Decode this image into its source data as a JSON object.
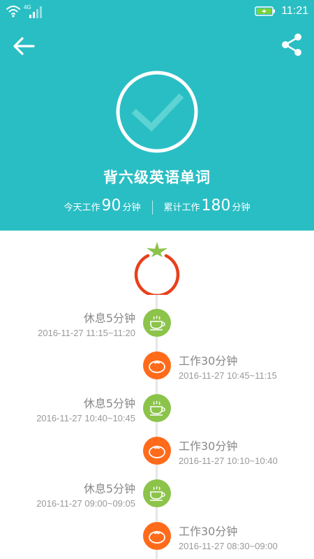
{
  "status_bar": {
    "network": "4G",
    "time": "11:21",
    "icons": [
      "wifi-icon",
      "signal-icon",
      "battery-charging-icon"
    ]
  },
  "header": {
    "task_title": "背六级英语单词",
    "today_label": "今天工作",
    "today_value": "90",
    "today_unit": "分钟",
    "total_label": "累计工作",
    "total_value": "180",
    "total_unit": "分钟"
  },
  "timeline": [
    {
      "type": "rest",
      "title": "休息5分钟",
      "time": "2016-11-27 11:15~11:20"
    },
    {
      "type": "work",
      "title": "工作30分钟",
      "time": "2016-11-27 10:45~11:15"
    },
    {
      "type": "rest",
      "title": "休息5分钟",
      "time": "2016-11-27 10:40~10:45"
    },
    {
      "type": "work",
      "title": "工作30分钟",
      "time": "2016-11-27 10:10~10:40"
    },
    {
      "type": "rest",
      "title": "休息5分钟",
      "time": "2016-11-27 09:00~09:05"
    },
    {
      "type": "work",
      "title": "工作30分钟",
      "time": "2016-11-27 08:30~09:00"
    }
  ],
  "colors": {
    "header_bg": "#29bec4",
    "rest": "#8cc34a",
    "work": "#ff6b1a",
    "tomato_ring": "#e8401c"
  }
}
